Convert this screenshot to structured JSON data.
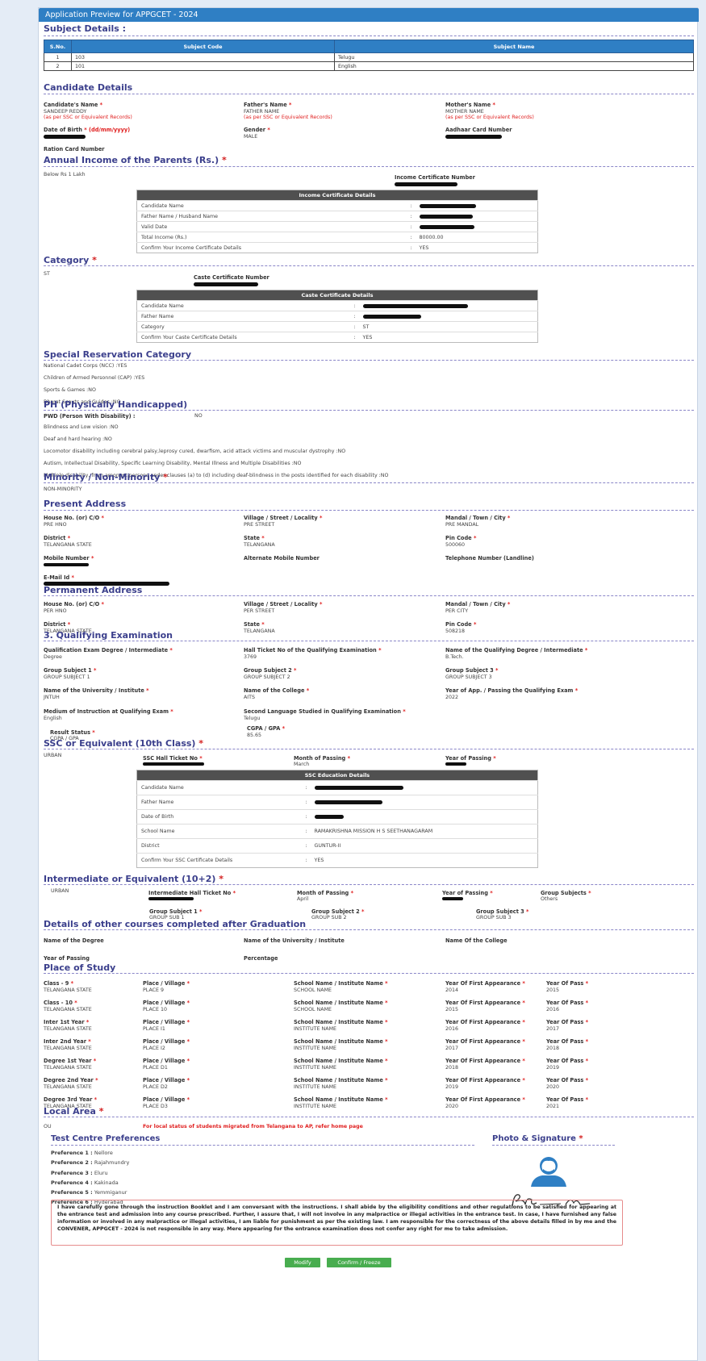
{
  "window": {
    "title": "Application Preview for APPGCET - 2024"
  },
  "sections": {
    "subject": "Subject Details :",
    "candidate": "Candidate Details",
    "income": "Annual Income of the Parents (Rs.)",
    "category": "Category",
    "special": "Special Reservation Category",
    "ph": "PH (Physically Handicapped)",
    "minority": "Minority / Non-Minority",
    "present": "Present Address",
    "permanent": "Permanent Address",
    "qualifying": "3. Qualifying Examination",
    "ssc": "SSC or Equivalent (10th Class)",
    "inter": "Intermediate or Equivalent (10+2)",
    "other": "Details of other courses completed after Graduation",
    "place": "Place of Study",
    "local": "Local Area",
    "centre": "Test Centre Preferences",
    "photo": "Photo & Signature",
    "req": "*"
  },
  "subject_table": {
    "headers": [
      "S.No.",
      "Subject Code",
      "Subject Name"
    ],
    "rows": [
      [
        "1",
        "103",
        "Telugu"
      ],
      [
        "2",
        "101",
        "English"
      ]
    ]
  },
  "candidate": {
    "name_label": "Candidate's Name",
    "name_value": "SANDEEP REDDY",
    "father_label": "Father's Name",
    "father_value": "FATHER NAME",
    "mother_label": "Mother's Name",
    "mother_value": "MOTHER NAME",
    "note": "(as per SSC or Equivalent Records)",
    "dob_label": "Date of Birth",
    "dob_format": "(dd/mm/yyyy)",
    "gender_label": "Gender",
    "gender_value": "MALE",
    "aadhaar_label": "Aadhaar Card Number",
    "ration_label": "Ration Card Number"
  },
  "income": {
    "value": "Below Rs 1 Lakh",
    "cert_label": "Income Certificate Number",
    "table_title": "Income Certificate Details",
    "rows": [
      {
        "label": "Candidate Name",
        "value": ""
      },
      {
        "label": "Father Name / Husband Name",
        "value": ""
      },
      {
        "label": "Valid Date",
        "value": ""
      },
      {
        "label": "Total Income (Rs.)",
        "value": "80000.00"
      },
      {
        "label": "Confirm Your Income Certificate Details",
        "value": "YES"
      }
    ],
    "sep": ":"
  },
  "category": {
    "value": "ST",
    "cert_label": "Caste Certificate Number",
    "table_title": "Caste Certificate Details",
    "rows": [
      {
        "label": "Candidate Name",
        "value": ""
      },
      {
        "label": "Father Name",
        "value": ""
      },
      {
        "label": "Category",
        "value": "ST"
      },
      {
        "label": "Confirm Your Caste Certificate Details",
        "value": "YES"
      }
    ]
  },
  "special": {
    "items": [
      "National Cadet Corps (NCC) :YES",
      "Children of Armed Personnel (CAP) :YES",
      "Sports & Games :NO",
      "Bharat Scouts and Guides :NO"
    ]
  },
  "ph": {
    "pwd_label": "PWD (Person With Disability) :",
    "pwd_value": "NO",
    "items": [
      "Blindness and Low vision :NO",
      "Deaf and hard hearing :NO",
      "Locomotor disability including cerebral palsy,leprosy cured, dwarfism, acid attack victims and muscular dystrophy :NO",
      "Autism, Intellectual Disability, Specific Learning Disability, Mental Illness and Multiple Disabilities :NO",
      "Multiple disability, from amongst persons under clauses (a) to (d) including deaf-blindness in the posts identified for each disability :NO"
    ]
  },
  "minority": {
    "value": "NON-MINORITY"
  },
  "present": {
    "house_label": "House No. (or) C/O",
    "house_value": "PRE HNO",
    "village_label": "Village / Street / Locality",
    "village_value": "PRE STREET",
    "mandal_label": "Mandal / Town / City",
    "mandal_value": "PRE MANDAL",
    "district_label": "District",
    "district_value": "TELANGANA STATE",
    "state_label": "State",
    "state_value": "TELANGANA",
    "pin_label": "Pin Code",
    "pin_value": "500060",
    "mobile_label": "Mobile Number",
    "alt_label": "Alternate Mobile Number",
    "tel_label": "Telephone Number (Landline)",
    "email_label": "E-Mail Id"
  },
  "permanent": {
    "house_value": "PER HNO",
    "village_value": "PER STREET",
    "mandal_value": "PER CITY",
    "district_value": "TELANGANA STATE",
    "state_value": "TELANGANA",
    "pin_value": "508218"
  },
  "qualifying": {
    "degree_label": "Qualification Exam Degree / Intermediate",
    "degree_value": "Degree",
    "hall_label": "Hall Ticket No of the Qualifying Examination",
    "hall_value": "3769",
    "qname_label": "Name of the Qualifying Degree / Intermediate",
    "qname_value": "B.Tech.",
    "g1_label": "Group Subject 1",
    "g1_value": "GROUP SUBJECT 1",
    "g2_label": "Group Subject 2",
    "g2_value": "GROUP SUBJECT 2",
    "g3_label": "Group Subject 3",
    "g3_value": "GROUP SUBJECT 3",
    "uni_label": "Name of the University / Institute",
    "uni_value": "JNTUH",
    "college_label": "Name of the College",
    "college_value": "AITS",
    "year_label": "Year of App. / Passing the Qualifying Exam",
    "year_value": "2022",
    "medium_label": "Medium of Instruction at Qualifying Exam",
    "medium_value": "English",
    "second_label": "Second Language Studied in Qualifying Examination",
    "second_value": "Telugu",
    "result_label": "Result Status",
    "result_value": "CGPA / GPA",
    "cgpa_label": "CGPA / GPA",
    "cgpa_value": "85.65"
  },
  "ssc": {
    "area": "URBAN",
    "hall_label": "SSC Hall Ticket No",
    "month_label": "Month of Passing",
    "month_value": "March",
    "year_label": "Year of Passing",
    "table_title": "SSC Education Details",
    "rows": [
      {
        "label": "Candidate Name",
        "value": ""
      },
      {
        "label": "Father Name",
        "value": ""
      },
      {
        "label": "Date of Birth",
        "value": ""
      },
      {
        "label": "School Name",
        "value": "RAMAKRISHNA MISSION H S SEETHANAGARAM"
      },
      {
        "label": "District",
        "value": "GUNTUR-II"
      },
      {
        "label": "Confirm Your SSC Certificate Details",
        "value": "YES"
      }
    ]
  },
  "inter": {
    "area": "URBAN",
    "hall_label": "Intermediate Hall Ticket No",
    "month_label": "Month of Passing",
    "month_value": "April",
    "year_label": "Year of Passing",
    "groups_label": "Group Subjects",
    "groups_value": "Others",
    "g1_label": "Group Subject 1",
    "g1_value": "GROUP SUB 1",
    "g2_label": "Group Subject 2",
    "g2_value": "GROUP SUB 2",
    "g3_label": "Group Subject 3",
    "g3_value": "GROUP SUB 3"
  },
  "other": {
    "degree_label": "Name of the Degree",
    "uni_label": "Name of the University / Institute",
    "college_label": "Name Of the College",
    "year_label": "Year of Passing",
    "pct_label": "Percentage"
  },
  "place": {
    "place_label": "Place / Village",
    "school_label": "School Name / Institute Name",
    "first_label": "Year Of First Appearance",
    "pass_label": "Year Of Pass",
    "rows": [
      {
        "cls": "Class - 9",
        "state": "TELANGANA STATE",
        "place": "PLACE 9",
        "school": "SCHOOL NAME",
        "first": "2014",
        "pass": "2015"
      },
      {
        "cls": "Class - 10",
        "state": "TELANGANA STATE",
        "place": "PLACE 10",
        "school": "SCHOOL NAME",
        "first": "2015",
        "pass": "2016"
      },
      {
        "cls": "Inter 1st Year",
        "state": "TELANGANA STATE",
        "place": "PLACE I1",
        "school": "INSTITUTE NAME",
        "first": "2016",
        "pass": "2017"
      },
      {
        "cls": "Inter 2nd Year",
        "state": "TELANGANA STATE",
        "place": "PLACE I2",
        "school": "INSTITUTE NAME",
        "first": "2017",
        "pass": "2018"
      },
      {
        "cls": "Degree 1st Year",
        "state": "TELANGANA STATE",
        "place": "PLACE D1",
        "school": "INSTITUTE NAME",
        "first": "2018",
        "pass": "2019"
      },
      {
        "cls": "Degree 2nd Year",
        "state": "TELANGANA STATE",
        "place": "PLACE D2",
        "school": "INSTITUTE NAME",
        "first": "2019",
        "pass": "2020"
      },
      {
        "cls": "Degree 3rd Year",
        "state": "TELANGANA STATE",
        "place": "PLACE D3",
        "school": "INSTITUTE NAME",
        "first": "2020",
        "pass": "2021"
      }
    ]
  },
  "local": {
    "value": "OU",
    "note": "For local status of students migrated from Telangana to AP, refer home page"
  },
  "prefs": [
    {
      "label": "Preference 1 :",
      "value": "Nellore"
    },
    {
      "label": "Preference 2 :",
      "value": "Rajahmundry"
    },
    {
      "label": "Preference 3 :",
      "value": "Eluru"
    },
    {
      "label": "Preference 4 :",
      "value": "Kakinada"
    },
    {
      "label": "Preference 5 :",
      "value": "Yemmiganur"
    },
    {
      "label": "Preference 6 :",
      "value": "Hyderabad"
    }
  ],
  "declaration": "I have carefully gone through the instruction Booklet and I am conversant with the instructions. I shall abide by the eligibility conditions and other regulations to be satisfied for appearing at the entrance test and admission into any course prescribed. Further, I assure that, I will not involve in any malpractice or illegal activities in the entrance test. In case, I have furnished any false information or involved in any malpractice or illegal activities, I am liable for punishment as per the existing law. I am responsible for the correctness of the above details filled in by me and the CONVENER, APPGCET - 2024 is not responsible in any way. Mere appearing for the entrance examination does not confer any right for me to take admission.",
  "buttons": {
    "modify": "Modify",
    "confirm": "Confirm / Freeze"
  },
  "colors": {
    "accent": "#2f7fc4",
    "section": "#3b3f8c",
    "required": "#e02020",
    "button": "#48ad4f"
  }
}
